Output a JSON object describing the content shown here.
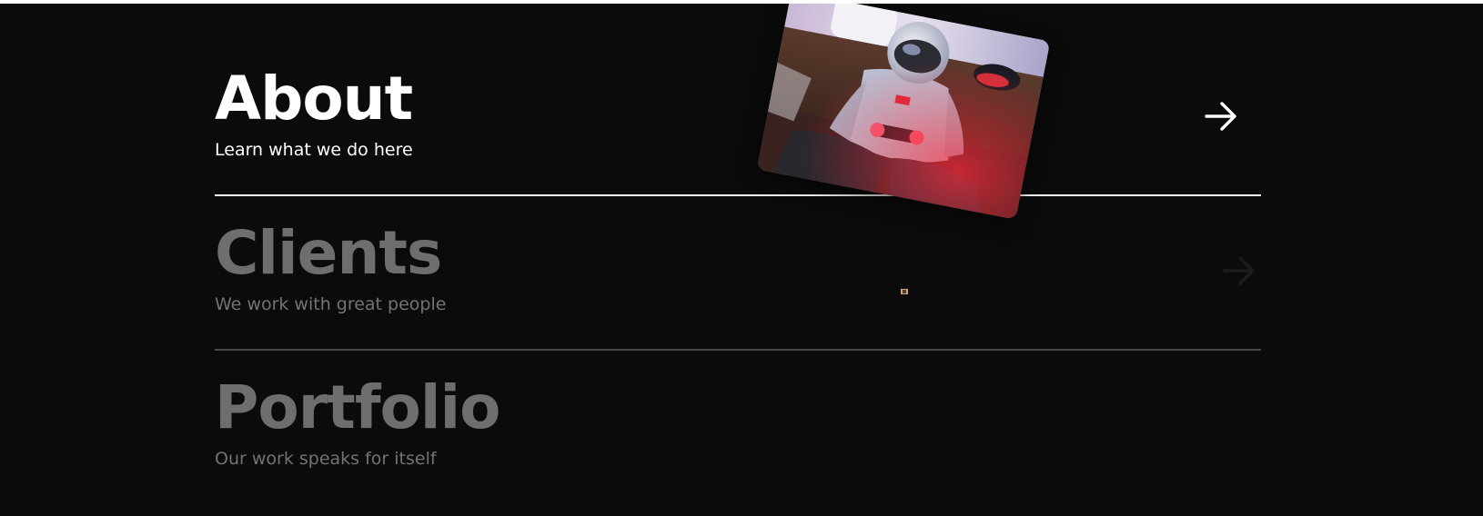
{
  "menu": {
    "items": [
      {
        "title": "About",
        "subtitle": "Learn what we do here",
        "state": "active",
        "arrow_icon": "arrow-right-icon"
      },
      {
        "title": "Clients",
        "subtitle": "We work with great people",
        "state": "inactive",
        "arrow_icon": "arrow-right-icon"
      },
      {
        "title": "Portfolio",
        "subtitle": "Our work speaks for itself",
        "state": "inactive"
      }
    ]
  },
  "hover_preview": {
    "image": "astronaut-gamer-photo"
  },
  "colors": {
    "background": "#0b0b0b",
    "active_text": "#ffffff",
    "inactive_text": "#6e6e6e",
    "active_divider": "#ffffff",
    "inactive_divider": "#4a4a4a",
    "inactive_arrow": "#1c1c1c"
  }
}
